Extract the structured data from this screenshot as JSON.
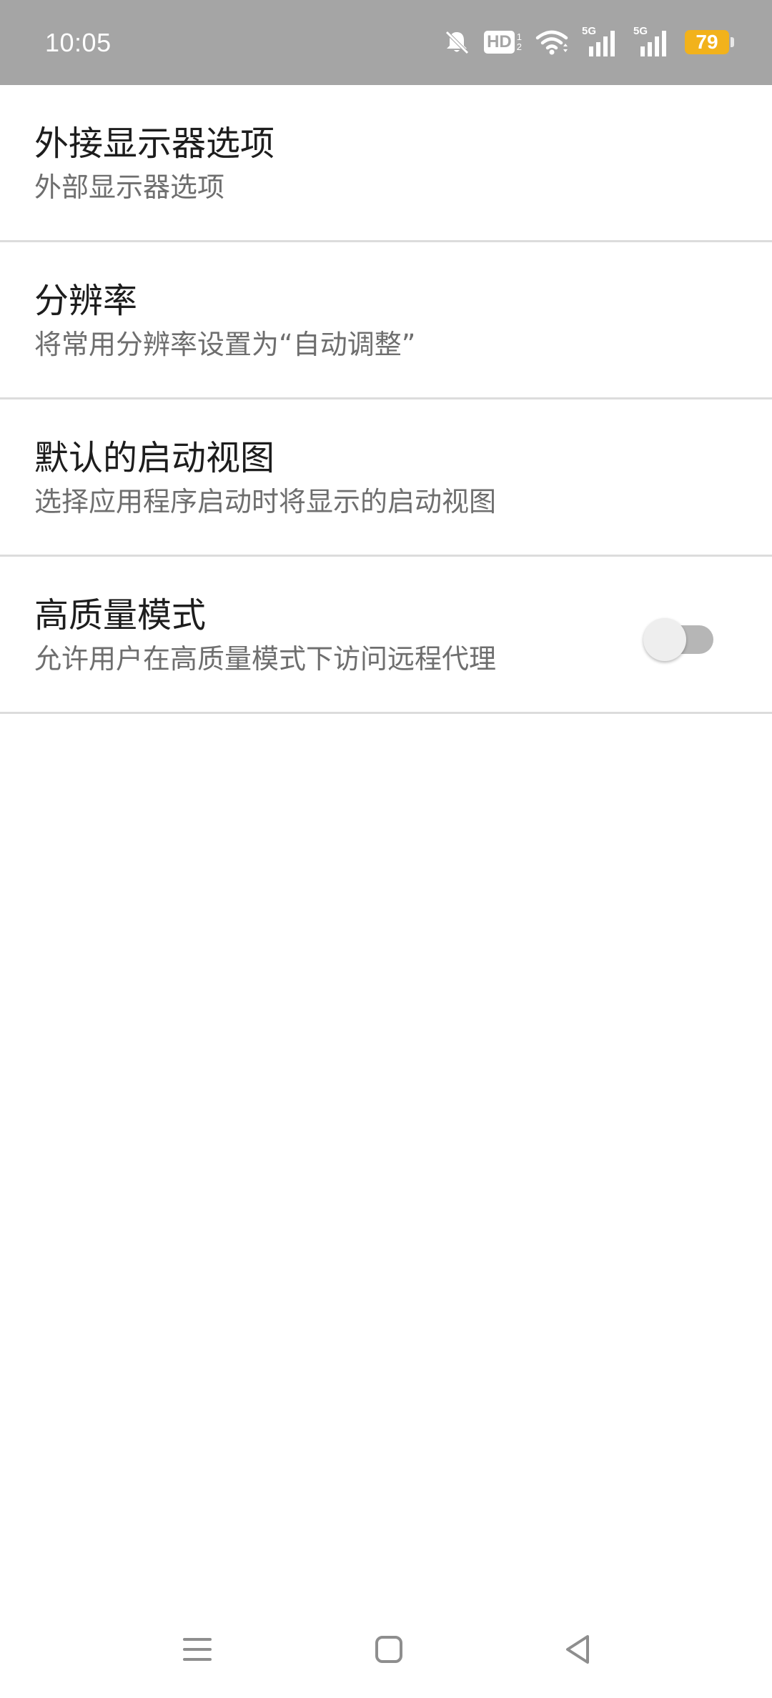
{
  "status_bar": {
    "time": "10:05",
    "icons": [
      "bell-off-icon",
      "hd-icon",
      "wifi-icon",
      "signal-5g-icon",
      "signal-5g-icon"
    ],
    "network_label_1": "5G",
    "network_label_2": "5G",
    "hd_label": "HD",
    "battery_level": "79",
    "battery_color": "#f2b21b"
  },
  "settings": {
    "items": [
      {
        "title": "外接显示器选项",
        "summary": "外部显示器选项"
      },
      {
        "title": "分辨率",
        "summary": "将常用分辨率设置为“自动调整”"
      },
      {
        "title": "默认的启动视图",
        "summary": "选择应用程序启动时将显示的启动视图"
      },
      {
        "title": "高质量模式",
        "summary": "允许用户在高质量模式下访问远程代理",
        "toggle_on": false
      }
    ]
  },
  "nav_bar": {
    "buttons": [
      "menu-icon",
      "home-icon",
      "back-icon"
    ]
  }
}
